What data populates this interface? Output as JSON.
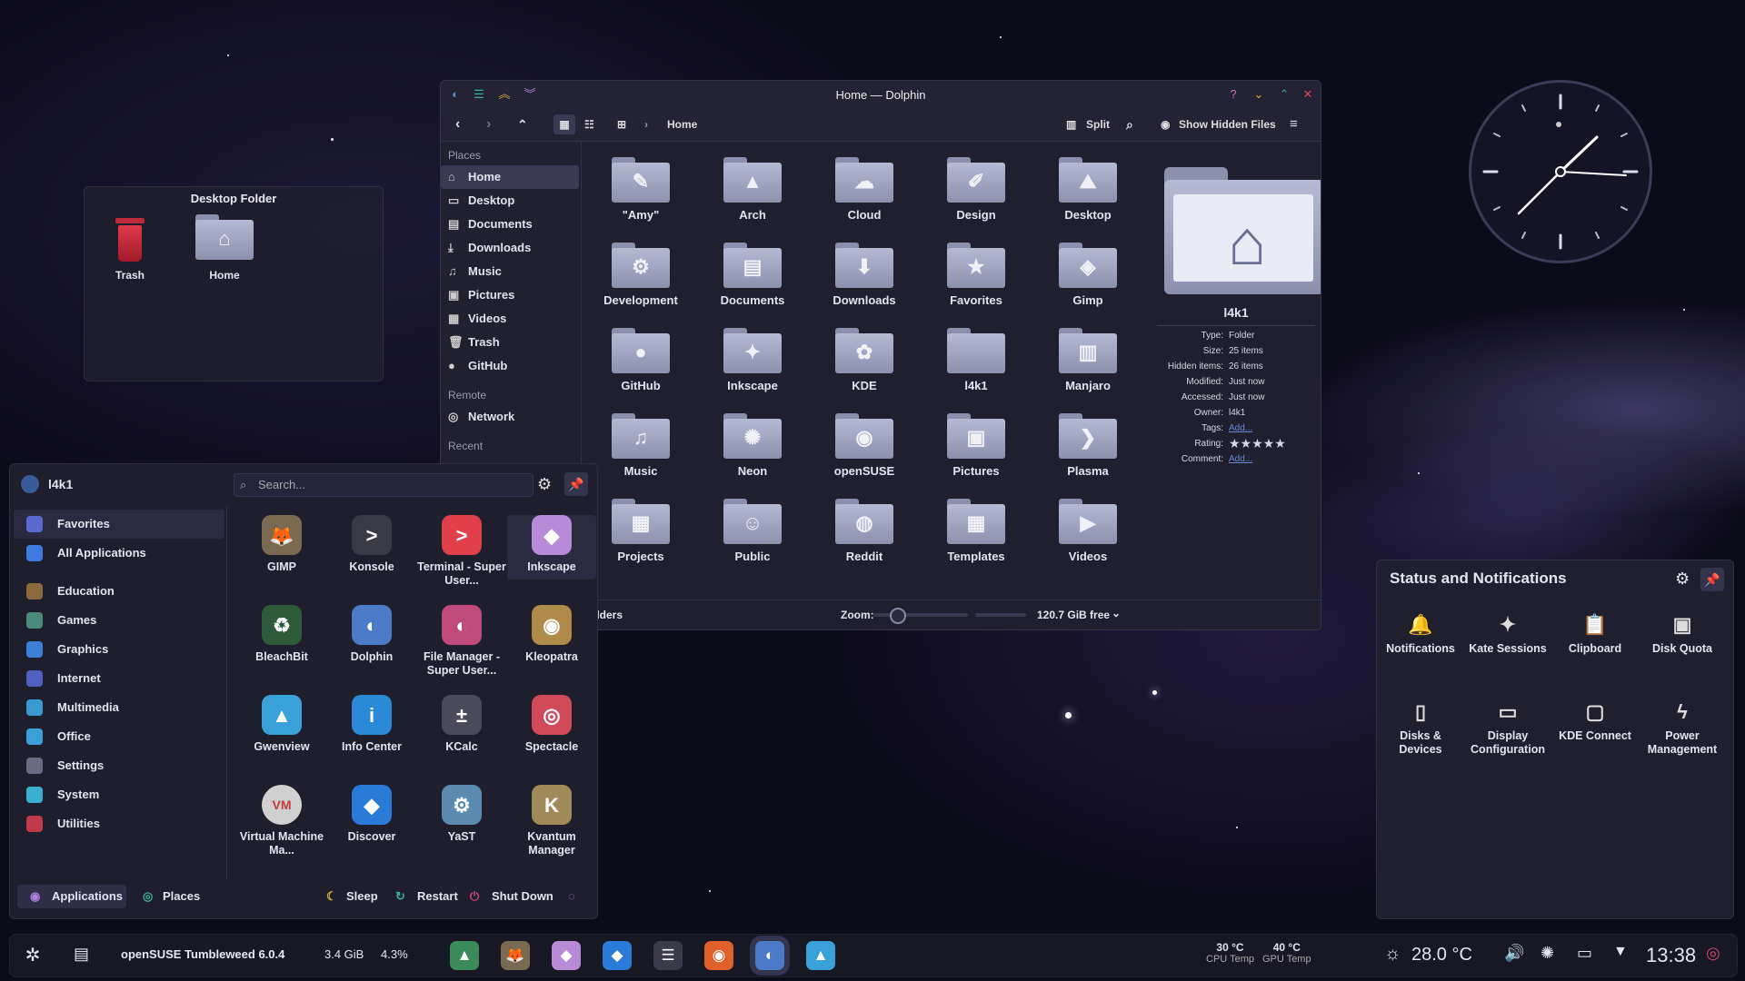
{
  "desktop_folder": {
    "title": "Desktop Folder",
    "items": [
      "Trash",
      "Home"
    ]
  },
  "dolphin": {
    "title": "Home — Dolphin",
    "breadcrumb": "Home",
    "toolbar": {
      "split": "Split",
      "show_hidden": "Show Hidden Files"
    },
    "places_heading": "Places",
    "places": [
      "Home",
      "Desktop",
      "Documents",
      "Downloads",
      "Music",
      "Pictures",
      "Videos",
      "Trash",
      "GitHub"
    ],
    "remote_heading": "Remote",
    "remote": [
      "Network"
    ],
    "recent_heading": "Recent",
    "files": [
      "\"Amy\"",
      "Arch",
      "Cloud",
      "Design",
      "Desktop",
      "Development",
      "Documents",
      "Downloads",
      "Favorites",
      "Gimp",
      "GitHub",
      "Inkscape",
      "KDE",
      "l4k1",
      "Manjaro",
      "Music",
      "Neon",
      "openSUSE",
      "Pictures",
      "Plasma",
      "Projects",
      "Public",
      "Reddit",
      "Templates",
      "Videos"
    ],
    "file_glyphs": [
      "✎",
      "▲",
      "☁",
      "✐",
      "⛰",
      "⚙",
      "▤",
      "⬇",
      "★",
      "◈",
      "●",
      "✦",
      "✿",
      "",
      "▥",
      "♫",
      "✺",
      "◉",
      "▣",
      "❯",
      "▦",
      "☺",
      "◍",
      "▦",
      "▶"
    ],
    "status_text": "folders",
    "zoom_label": "Zoom:",
    "free_space": "120.7 GiB free",
    "info": {
      "name": "l4k1",
      "rows": [
        {
          "k": "Type:",
          "v": "Folder"
        },
        {
          "k": "Size:",
          "v": "25 items"
        },
        {
          "k": "Hidden items:",
          "v": "26 items"
        },
        {
          "k": "Modified:",
          "v": "Just now"
        },
        {
          "k": "Accessed:",
          "v": "Just now"
        },
        {
          "k": "Owner:",
          "v": "l4k1"
        },
        {
          "k": "Tags:",
          "v": "Add..."
        },
        {
          "k": "Rating:",
          "v": "★★★★★"
        },
        {
          "k": "Comment:",
          "v": "Add..."
        }
      ]
    }
  },
  "launcher": {
    "user": "l4k1",
    "search_placeholder": "Search...",
    "categories": [
      "Favorites",
      "All Applications",
      "Education",
      "Games",
      "Graphics",
      "Internet",
      "Multimedia",
      "Office",
      "Settings",
      "System",
      "Utilities"
    ],
    "category_colors": [
      "#5b6ad0",
      "#3d7be0",
      "#8a6a3c",
      "#4a8a7a",
      "#3c7fd8",
      "#5060c0",
      "#3a9ad0",
      "#3aa0d8",
      "#6a6a80",
      "#3ab0d0",
      "#c03a4a"
    ],
    "apps": [
      {
        "name": "GIMP",
        "glyph": "🦊",
        "color": "#7a6a52"
      },
      {
        "name": "Konsole",
        "glyph": ">",
        "color": "#3a3a44"
      },
      {
        "name": "Terminal - Super User...",
        "glyph": ">",
        "color": "#e0404a"
      },
      {
        "name": "Inkscape",
        "glyph": "◆",
        "color": "#b98ad8"
      },
      {
        "name": "BleachBit",
        "glyph": "♻",
        "color": "#2f5a3a"
      },
      {
        "name": "Dolphin",
        "glyph": "◐",
        "color": "#4a7ac8"
      },
      {
        "name": "File Manager - Super User...",
        "glyph": "◐",
        "color": "#c04a7a"
      },
      {
        "name": "Kleopatra",
        "glyph": "◉",
        "color": "#b08a4a"
      },
      {
        "name": "Gwenview",
        "glyph": "▲",
        "color": "#3aa0d8"
      },
      {
        "name": "Info Center",
        "glyph": "i",
        "color": "#2a8ad8"
      },
      {
        "name": "KCalc",
        "glyph": "±",
        "color": "#4a4a5a"
      },
      {
        "name": "Spectacle",
        "glyph": "◎",
        "color": "#d04a5a"
      },
      {
        "name": "Virtual Machine Ma...",
        "glyph": "VM",
        "color": "#d0d0d0"
      },
      {
        "name": "Discover",
        "glyph": "◆",
        "color": "#2a7ad8"
      },
      {
        "name": "YaST",
        "glyph": "⚙",
        "color": "#5a8ab0"
      },
      {
        "name": "Kvantum Manager",
        "glyph": "K",
        "color": "#a08a5a"
      }
    ],
    "footer": {
      "applications": "Applications",
      "places": "Places",
      "sleep": "Sleep",
      "restart": "Restart",
      "shutdown": "Shut Down"
    }
  },
  "status_notifications": {
    "title": "Status and Notifications",
    "items": [
      {
        "label": "Notifications",
        "glyph": "🔔"
      },
      {
        "label": "Kate Sessions",
        "glyph": "✦"
      },
      {
        "label": "Clipboard",
        "glyph": "📋"
      },
      {
        "label": "Disk Quota",
        "glyph": "▣"
      },
      {
        "label": "Disks & Devices",
        "glyph": "▯"
      },
      {
        "label": "Display Configuration",
        "glyph": "▭"
      },
      {
        "label": "KDE Connect",
        "glyph": "▢"
      },
      {
        "label": "Power Management",
        "glyph": "ϟ"
      }
    ]
  },
  "taskbar": {
    "system_name": "openSUSE Tumbleweed 6.0.4",
    "memory": "3.4 GiB",
    "cpu": "4.3%",
    "cpu_temp": "30 °C",
    "cpu_temp_label": "CPU Temp",
    "gpu_temp": "40 °C",
    "gpu_temp_label": "GPU Temp",
    "weather_temp": "28.0 °C",
    "time": "13:38",
    "tasks": [
      {
        "name": "gwenview-task",
        "glyph": "▲",
        "color": "#3a8a5a"
      },
      {
        "name": "gimp-task",
        "glyph": "🦊",
        "color": "#7a6a52"
      },
      {
        "name": "inkscape-task",
        "glyph": "◆",
        "color": "#b98ad8"
      },
      {
        "name": "discover-task",
        "glyph": "◆",
        "color": "#2a7ad8"
      },
      {
        "name": "mixer-task",
        "glyph": "☰",
        "color": "#3a3a48"
      },
      {
        "name": "firefox-task",
        "glyph": "◉",
        "color": "#e0602a"
      },
      {
        "name": "dolphin-task",
        "glyph": "◐",
        "color": "#4a7ac8"
      },
      {
        "name": "gwenview2-task",
        "glyph": "▲",
        "color": "#3aa0d8"
      }
    ]
  }
}
